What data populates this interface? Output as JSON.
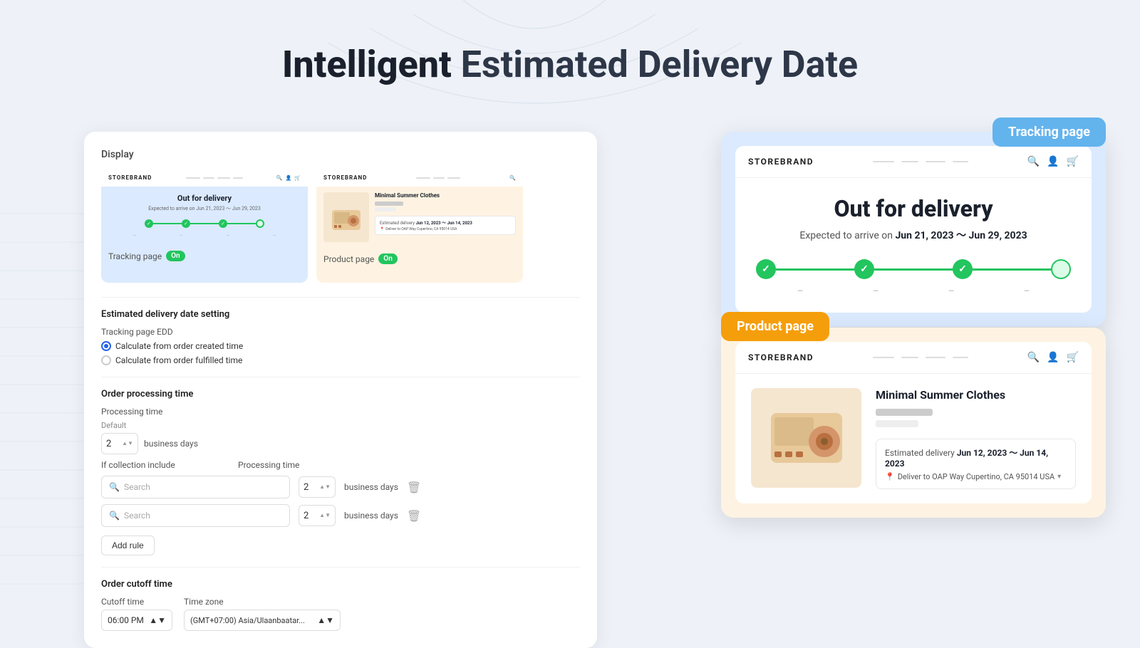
{
  "page": {
    "title": "Intelligent Estimated Delivery Date",
    "title_bold": "Intelligent",
    "title_rest": " Estimated Delivery Date"
  },
  "display_section": {
    "label": "Display"
  },
  "tracking_preview": {
    "status": "Out for delivery",
    "expected": "Expected to arrive on",
    "date_range": "Jun 21, 2023 ～ Jun 29, 2023",
    "badge_label": "Tracking page",
    "badge_on": "On",
    "store_logo": "STOREBRAND",
    "steps": [
      "",
      "",
      "",
      ""
    ]
  },
  "product_preview": {
    "product_title": "Minimal Summer Clothes",
    "badge_label": "Product page",
    "badge_on": "On",
    "store_logo": "STOREBRAND",
    "estimated_delivery_label": "Estimated delivery",
    "estimated_delivery_dates": "Jun 12, 2023 ～ Jun 14, 2023",
    "delivery_to": "Deliver to OAP Way Cupertino, CA 95014 USA"
  },
  "settings": {
    "edd_section_title": "Estimated delivery date setting",
    "tracking_page_edd_label": "Tracking page EDD",
    "radio_option1": "Calculate from order created time",
    "radio_option2": "Calculate from order fulfilled time",
    "processing_section_title": "Order processing time",
    "processing_time_label": "Processing time",
    "default_label": "Default",
    "default_value": "2",
    "business_days_label": "business days",
    "if_collection_label": "If collection include",
    "processing_time_col_label": "Processing time",
    "search_placeholder1": "Search",
    "search_placeholder2": "Search",
    "processing_value1": "2",
    "processing_value2": "2",
    "add_rule_label": "Add rule",
    "cutoff_section_title": "Order cutoff time",
    "cutoff_time_label": "Cutoff time",
    "cutoff_time_value": "06:00 PM",
    "timezone_label": "Time zone",
    "timezone_value": "(GMT+07:00) Asia/Ulaanbaatar..."
  },
  "tracking_popup": {
    "label": "Tracking page",
    "store_logo": "STOREBRAND",
    "status": "Out for delivery",
    "expected_prefix": "Expected to arrive on",
    "date_bold": "Jun 21, 2023",
    "date_tilde": "～",
    "date_end": "Jun 29, 2023",
    "step_labels": [
      "",
      "",
      "",
      ""
    ]
  },
  "product_popup": {
    "label": "Product page",
    "store_logo": "STOREBRAND",
    "product_title": "Minimal Summer Clothes",
    "estimated_delivery_label": "Estimated delivery",
    "estimated_delivery_dates": "Jun 12, 2023 ～ Jun 14, 2023",
    "deliver_to": "Deliver to OAP Way Cupertino, CA 95014 USA"
  }
}
